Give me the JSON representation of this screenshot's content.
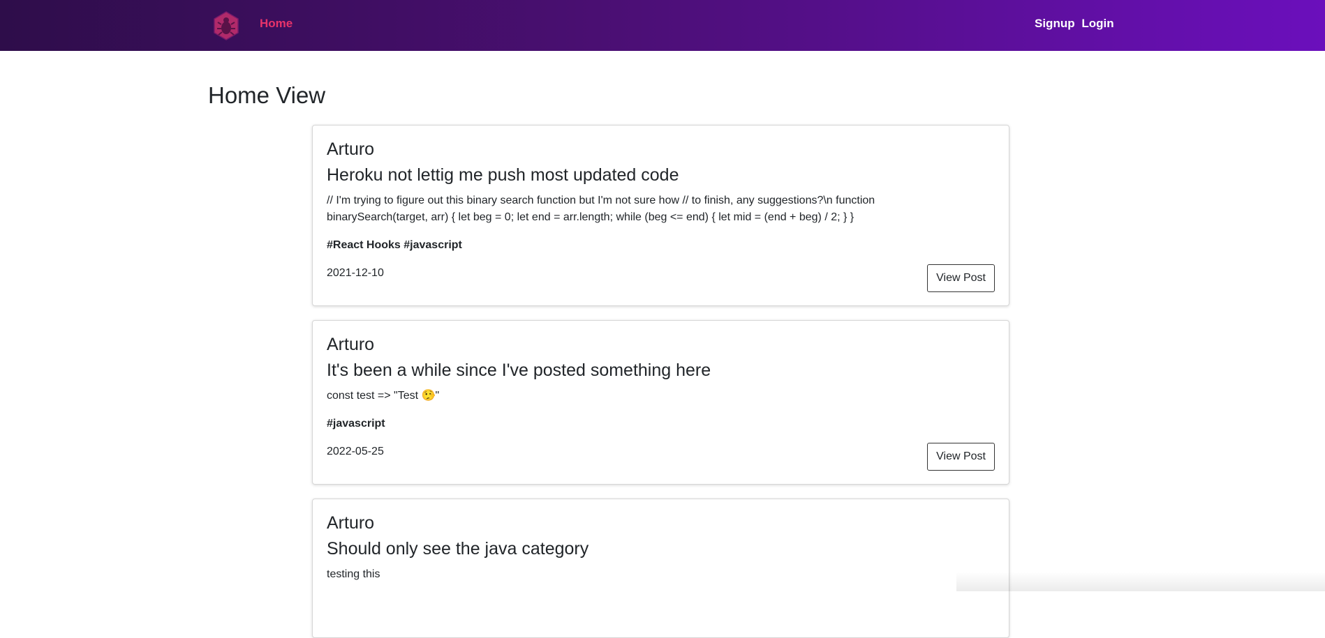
{
  "nav": {
    "logo_icon": "bug-hexagon-icon",
    "home_label": "Home",
    "signup_label": "Signup",
    "login_label": "Login",
    "home_color": "#e8336a"
  },
  "page": {
    "title": "Home View"
  },
  "posts": [
    {
      "author": "Arturo",
      "title": "Heroku not lettig me push most updated code",
      "body": "// I'm trying to figure out this binary search function but I'm not sure how // to finish, any suggestions?\\n function binarySearch(target, arr) { let beg = 0; let end = arr.length; while (beg <= end) { let mid = (end + beg) / 2; } }",
      "tags": "#React Hooks #javascript",
      "date": "2021-12-10",
      "button": "View Post"
    },
    {
      "author": "Arturo",
      "title": "It's been a while since I've posted something here",
      "body": "const test => \"Test 🤥\"",
      "tags": "#javascript",
      "date": "2022-05-25",
      "button": "View Post"
    },
    {
      "author": "Arturo",
      "title": "Should only see the java category",
      "body": "testing this"
    }
  ]
}
